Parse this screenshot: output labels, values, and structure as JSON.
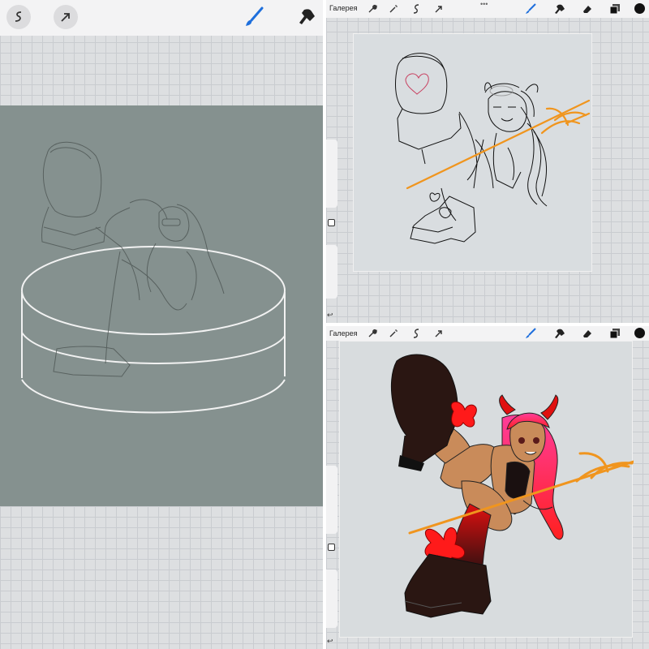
{
  "left_panel": {
    "toolbar": {
      "adjust_icon": "adjustments-icon",
      "select_icon": "selection-arrow-icon",
      "brush_icon": "brush-icon",
      "smudge_icon": "smudge-icon"
    },
    "canvas_color": "#85918f"
  },
  "top_right_panel": {
    "gallery_label": "Галерея",
    "more_dots": "•••",
    "brush_color": "#1e6fdc"
  },
  "bottom_right_panel": {
    "gallery_label": "Галерея",
    "current_color": "#111111"
  },
  "colors": {
    "accent_blue": "#1e6fdc",
    "pitchfork_orange": "#f0951e",
    "hair_pink": "#ff3d9a",
    "bow_red": "#ff1a1a",
    "boot_dark": "#2a1612"
  }
}
